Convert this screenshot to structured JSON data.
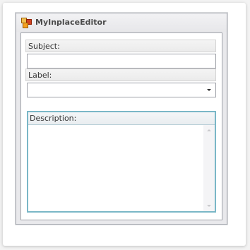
{
  "window": {
    "title": "MyInplaceEditor",
    "icon": "app-icon"
  },
  "form": {
    "subject_label": "Subject:",
    "subject_value": "",
    "label_label": "Label:",
    "label_value": "",
    "description_label": "Description:",
    "description_value": ""
  },
  "colors": {
    "focus_border": "#7ab7c7",
    "window_bg": "#e9e9ec"
  }
}
